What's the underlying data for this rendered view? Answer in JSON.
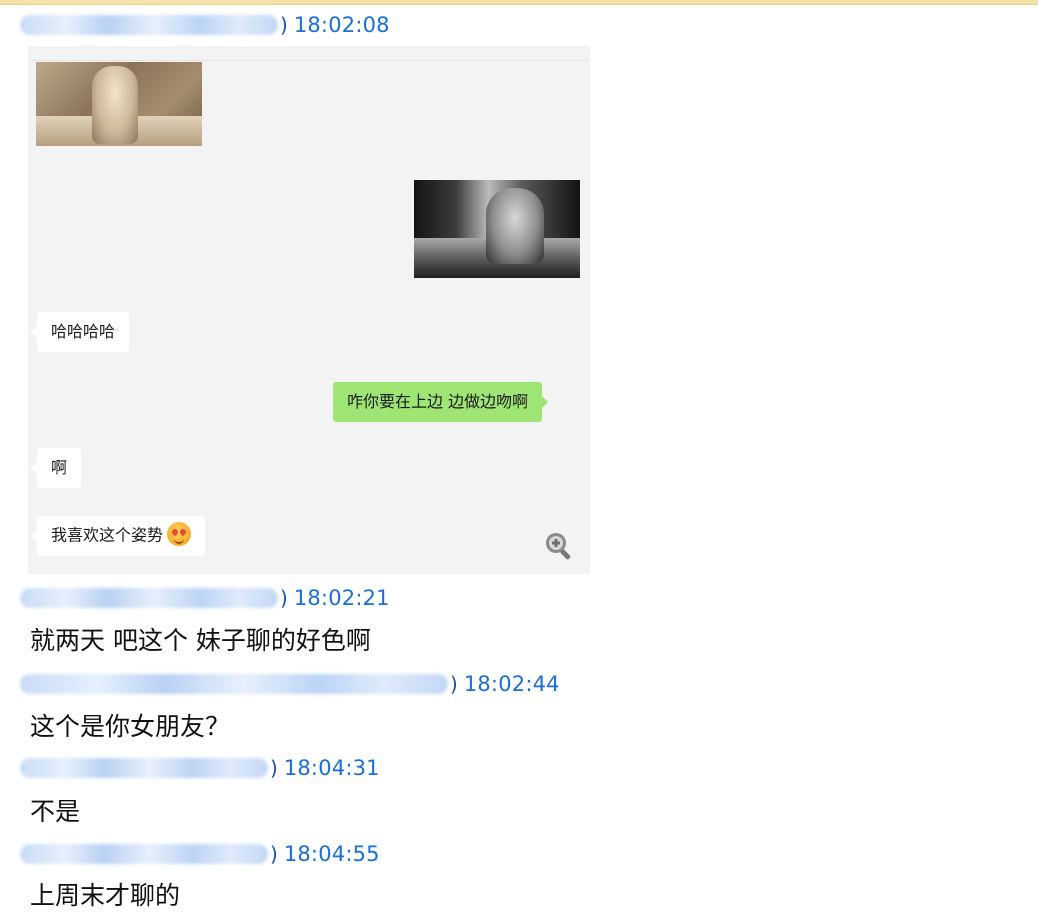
{
  "colors": {
    "timestamp": "#1a6ddc",
    "sender_blur": "#c9dcf6",
    "chat_background": "#f3f3f3",
    "bubble_incoming": "#ffffff",
    "bubble_outgoing": "#9fe574",
    "top_border": "#f4e2a8"
  },
  "messages": [
    {
      "timestamp": "18:02:08",
      "closing_paren": ")",
      "content_type": "image"
    },
    {
      "timestamp": "18:02:21",
      "closing_paren": ")",
      "text": "就两天  吧这个 妹子聊的好色啊"
    },
    {
      "timestamp": "18:02:44",
      "closing_paren": ")",
      "text": "这个是你女朋友？"
    },
    {
      "timestamp": "18:04:31",
      "closing_paren": ")",
      "text": "不是"
    },
    {
      "timestamp": "18:04:55",
      "closing_paren": ")",
      "text": "上周末才聊的"
    }
  ],
  "shared_screenshot": {
    "bubbles": [
      {
        "side": "left",
        "text": "哈哈哈哈"
      },
      {
        "side": "right",
        "text": "咋你要在上边 边做边吻啊"
      },
      {
        "side": "left",
        "text": "啊"
      },
      {
        "side": "left",
        "text": "我喜欢这个姿势",
        "emoji": "heart-eyes-emoji"
      }
    ],
    "icons": {
      "zoom": "zoom-in-icon"
    }
  }
}
